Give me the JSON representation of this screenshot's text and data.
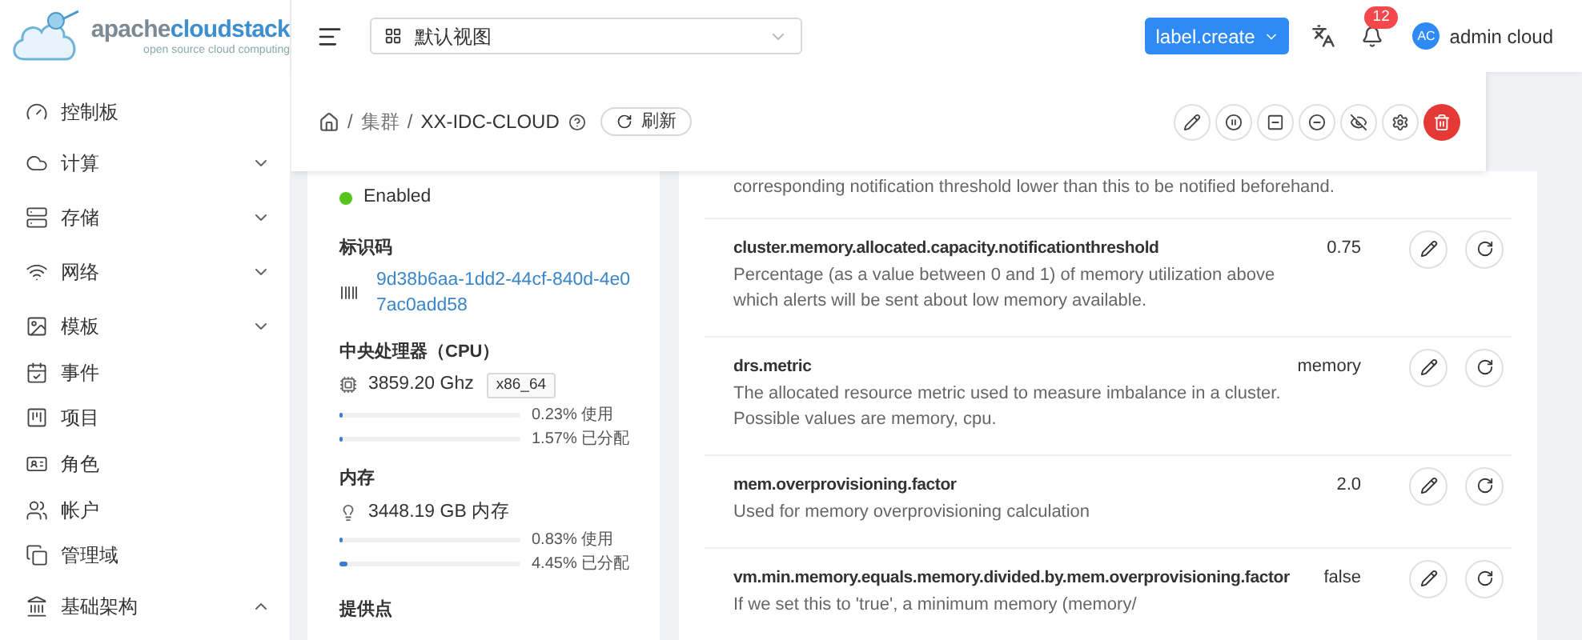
{
  "logo": {
    "brand_prefix": "apache",
    "brand_suffix": "cloudstack",
    "tagline": "open source cloud computing"
  },
  "sidebar": {
    "items": [
      {
        "label": "控制板"
      },
      {
        "label": "计算",
        "expanded": false
      },
      {
        "label": "存储",
        "expanded": false
      },
      {
        "label": "网络",
        "expanded": false
      },
      {
        "label": "模板",
        "expanded": false
      },
      {
        "label": "事件"
      },
      {
        "label": "项目"
      },
      {
        "label": "角色"
      },
      {
        "label": "帐户"
      },
      {
        "label": "管理域"
      },
      {
        "label": "基础架构",
        "expanded": true
      }
    ]
  },
  "header": {
    "view_select": {
      "value": "默认视图"
    },
    "create_button": "label.create",
    "notification_count": "12",
    "avatar": "AC",
    "user": "admin cloud"
  },
  "toolbar": {
    "separator": "/",
    "breadcrumb": [
      "集群",
      "XX-IDC-CLOUD"
    ],
    "refresh": "刷新",
    "actions": [
      {
        "kind": "edit"
      },
      {
        "kind": "pause"
      },
      {
        "kind": "minus-square"
      },
      {
        "kind": "minus-circle"
      },
      {
        "kind": "eye-off"
      },
      {
        "kind": "settings"
      },
      {
        "kind": "delete"
      }
    ]
  },
  "details": {
    "status": {
      "value": "Enabled",
      "enabled": true
    },
    "id": {
      "label": "标识码",
      "value_lines": [
        "9d38b6aa-1dd2-44cf-840d-4e0",
        "7ac0add58"
      ]
    },
    "cpu": {
      "label": "中央处理器（CPU）",
      "value": "3859.20 Ghz",
      "tag": "x86_64",
      "bars": [
        {
          "level": 0.0023,
          "reading": "0.23% 使用"
        },
        {
          "level": 0.0157,
          "reading": "1.57% 已分配"
        }
      ]
    },
    "memory": {
      "label": "内存",
      "value": "3448.19 GB 内存",
      "bars": [
        {
          "level": 0.0083,
          "reading": "0.83% 使用"
        },
        {
          "level": 0.0445,
          "reading": "4.45% 已分配"
        }
      ]
    },
    "pod": {
      "label": "提供点"
    }
  },
  "settings": {
    "leading_text": "corresponding notification threshold lower than this to be notified beforehand.",
    "rows": [
      {
        "name": "cluster.memory.allocated.capacity.notificationthreshold",
        "value": "0.75",
        "description": "Percentage (as a value between 0 and 1) of memory utilization above which alerts will be sent about low memory available."
      },
      {
        "name": "drs.metric",
        "value": "memory",
        "description": "The allocated resource metric used to measure imbalance in a cluster. Possible values are memory, cpu."
      },
      {
        "name": "mem.overprovisioning.factor",
        "value": "2.0",
        "description": "Used for memory overprovisioning calculation"
      },
      {
        "name": "vm.min.memory.equals.memory.divided.by.mem.overprovisioning.factor",
        "value": "false",
        "description": "If we set this to 'true', a minimum memory (memory/"
      }
    ]
  }
}
